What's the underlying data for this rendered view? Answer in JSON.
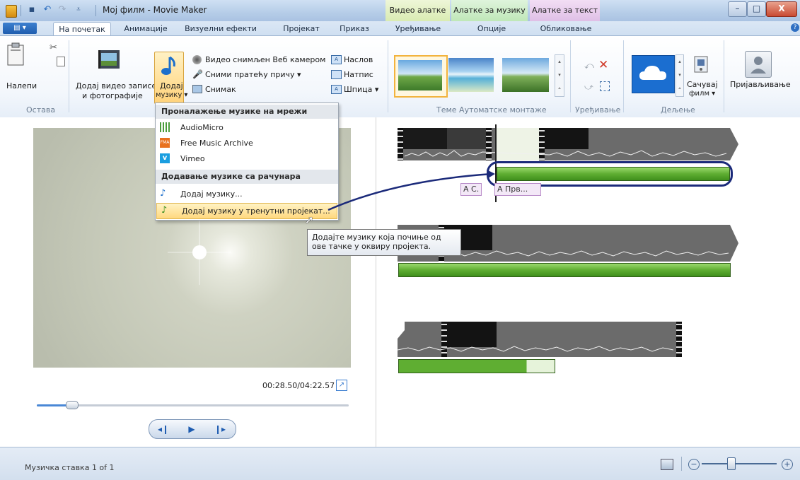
{
  "window": {
    "title": "Мој филм - Movie Maker",
    "context_tabs": [
      "Видео алатке",
      "Алатке за музику",
      "Алатке за текст"
    ],
    "controls": {
      "minimize": "–",
      "maximize": "□",
      "close": "X"
    }
  },
  "tabs": {
    "file": "▤ ▾",
    "items": [
      "На почетак",
      "Анимације",
      "Визуелни ефекти",
      "Пројекат",
      "Приказ"
    ],
    "context": [
      "Уређивање",
      "Опције",
      "Обликовање"
    ]
  },
  "ribbon": {
    "paste": "Налепи",
    "add_videos_line1": "Додај видео записе",
    "add_videos_line2": "и фотографије",
    "add_music_line1": "Додај",
    "add_music_line2": "музику ▾",
    "webcam": "Видео снимљен Веб камером",
    "narration": "Сними пратећу причу ▾",
    "snapshot": "Снимак",
    "title": "Наслов",
    "caption": "Натпис",
    "credits": "Шпица ▾",
    "save_movie_line1": "Сачувај",
    "save_movie_line2": "филм ▾",
    "sign_in": "Пријављивање",
    "group_labels": {
      "clipboard": "Остава",
      "themes": "Теме Аутоматске монтаже",
      "editing": "Уређивање",
      "sharing": "Дељење"
    }
  },
  "menu": {
    "header_online": "Проналажење музике на мрежи",
    "items_online": [
      "AudioMicro",
      "Free Music Archive",
      "Vimeo"
    ],
    "header_pc": "Додавање музике са рачунара",
    "item_add": "Додај музику...",
    "item_add_current": "Додај музику у тренутни пројекат...",
    "fma_badge": "FMA",
    "vimeo_badge": "v"
  },
  "tooltip": {
    "line1": "Додајте музику која почиње од",
    "line2": "ове тачке у оквиру пројекта."
  },
  "preview": {
    "timecode": "00:28.50/04:22.57",
    "seek_fraction": 0.11
  },
  "storyboard": {
    "caption_a": "A C.",
    "caption_b": "A Прв..."
  },
  "status": {
    "text": "Музичка ставка 1 of 1"
  },
  "colors": {
    "accent": "#1f5eaf",
    "music_green": "#5fae32",
    "highlight_oval": "#1b2a7a"
  }
}
